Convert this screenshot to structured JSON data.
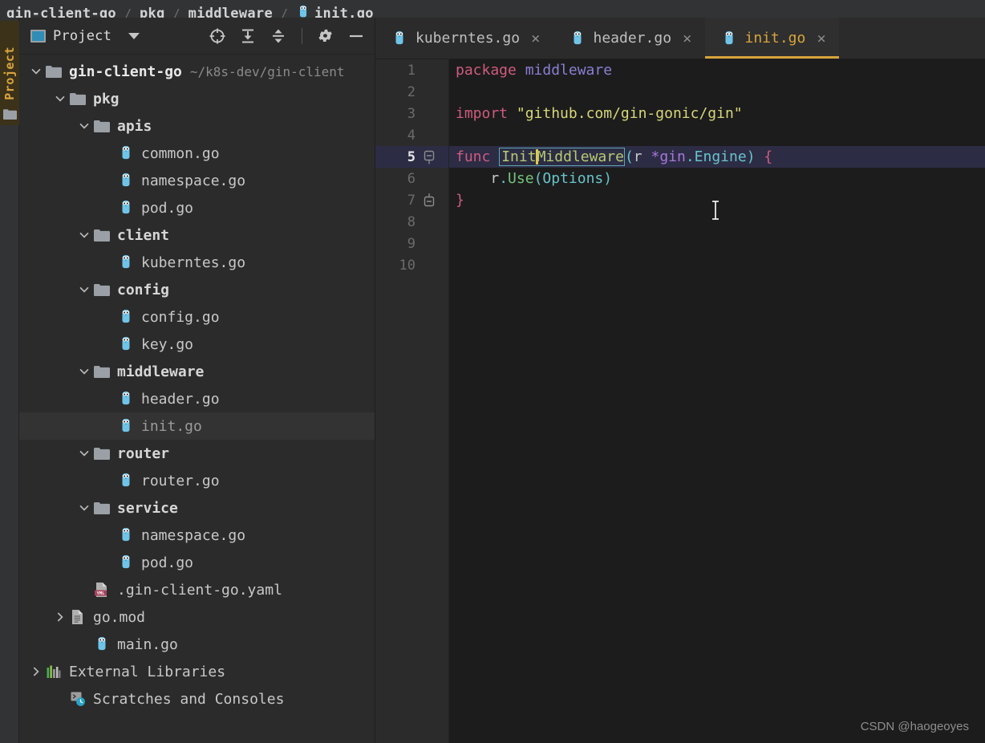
{
  "breadcrumb": {
    "items": [
      "gin-client-go",
      "pkg",
      "middleware",
      "init.go"
    ],
    "separator": "/",
    "file_icon": "go-gopher-icon"
  },
  "tool_window_tab": {
    "label": "Project",
    "icon": "folder-icon"
  },
  "project_panel": {
    "title": "Project",
    "window_icon": "project-window-icon",
    "dropdown_icon": "chevron-down-icon",
    "tools": [
      {
        "name": "locate-icon",
        "title": "Select Opened File"
      },
      {
        "name": "expand-all-icon",
        "title": "Expand All"
      },
      {
        "name": "collapse-all-icon",
        "title": "Collapse All"
      },
      {
        "name": "settings-gear-icon",
        "title": "Settings"
      },
      {
        "name": "hide-icon",
        "title": "Hide"
      }
    ],
    "tree": [
      {
        "indent": 0,
        "arrow": "expanded",
        "icon": "folder-icon",
        "label": "gin-client-go",
        "style": "root",
        "path": "~/k8s-dev/gin-client",
        "selected": false
      },
      {
        "indent": 1,
        "arrow": "expanded",
        "icon": "folder-icon",
        "label": "pkg",
        "style": "dir",
        "selected": false
      },
      {
        "indent": 2,
        "arrow": "expanded",
        "icon": "folder-icon",
        "label": "apis",
        "style": "dir",
        "selected": false
      },
      {
        "indent": 3,
        "arrow": "none",
        "icon": "go-gopher-icon",
        "label": "common.go",
        "style": "file",
        "selected": false
      },
      {
        "indent": 3,
        "arrow": "none",
        "icon": "go-gopher-icon",
        "label": "namespace.go",
        "style": "file",
        "selected": false
      },
      {
        "indent": 3,
        "arrow": "none",
        "icon": "go-gopher-icon",
        "label": "pod.go",
        "style": "file",
        "selected": false
      },
      {
        "indent": 2,
        "arrow": "expanded",
        "icon": "folder-icon",
        "label": "client",
        "style": "dir",
        "selected": false
      },
      {
        "indent": 3,
        "arrow": "none",
        "icon": "go-gopher-icon",
        "label": "kuberntes.go",
        "style": "file",
        "selected": false
      },
      {
        "indent": 2,
        "arrow": "expanded",
        "icon": "folder-icon",
        "label": "config",
        "style": "dir",
        "selected": false
      },
      {
        "indent": 3,
        "arrow": "none",
        "icon": "go-gopher-icon",
        "label": "config.go",
        "style": "file",
        "selected": false
      },
      {
        "indent": 3,
        "arrow": "none",
        "icon": "go-gopher-icon",
        "label": "key.go",
        "style": "file",
        "selected": false
      },
      {
        "indent": 2,
        "arrow": "expanded",
        "icon": "folder-icon",
        "label": "middleware",
        "style": "dir",
        "selected": false
      },
      {
        "indent": 3,
        "arrow": "none",
        "icon": "go-gopher-icon",
        "label": "header.go",
        "style": "file",
        "selected": false
      },
      {
        "indent": 3,
        "arrow": "none",
        "icon": "go-gopher-icon",
        "label": "init.go",
        "style": "file-dim",
        "selected": true
      },
      {
        "indent": 2,
        "arrow": "expanded",
        "icon": "folder-icon",
        "label": "router",
        "style": "dir",
        "selected": false
      },
      {
        "indent": 3,
        "arrow": "none",
        "icon": "go-gopher-icon",
        "label": "router.go",
        "style": "file",
        "selected": false
      },
      {
        "indent": 2,
        "arrow": "expanded",
        "icon": "folder-icon",
        "label": "service",
        "style": "dir",
        "selected": false
      },
      {
        "indent": 3,
        "arrow": "none",
        "icon": "go-gopher-icon",
        "label": "namespace.go",
        "style": "file",
        "selected": false
      },
      {
        "indent": 3,
        "arrow": "none",
        "icon": "go-gopher-icon",
        "label": "pod.go",
        "style": "file",
        "selected": false
      },
      {
        "indent": 2,
        "arrow": "none",
        "icon": "yaml-file-icon",
        "label": ".gin-client-go.yaml",
        "style": "file",
        "selected": false
      },
      {
        "indent": 1,
        "arrow": "collapsed",
        "icon": "text-file-icon",
        "label": "go.mod",
        "style": "file",
        "selected": false
      },
      {
        "indent": 2,
        "arrow": "none",
        "icon": "go-gopher-icon",
        "label": "main.go",
        "style": "file",
        "selected": false
      },
      {
        "indent": 0,
        "arrow": "collapsed",
        "icon": "libraries-icon",
        "label": "External Libraries",
        "style": "file",
        "selected": false
      },
      {
        "indent": 1,
        "arrow": "none",
        "icon": "scratches-icon",
        "label": "Scratches and Consoles",
        "style": "file",
        "selected": false
      }
    ]
  },
  "editor": {
    "tabs": [
      {
        "label": "kuberntes.go",
        "icon": "go-gopher-icon",
        "active": false,
        "close": "×"
      },
      {
        "label": "header.go",
        "icon": "go-gopher-icon",
        "active": false,
        "close": "×"
      },
      {
        "label": "init.go",
        "icon": "go-gopher-icon",
        "active": true,
        "close": "×"
      }
    ],
    "line_numbers": [
      "1",
      "2",
      "3",
      "4",
      "5",
      "6",
      "7",
      "8",
      "9",
      "10"
    ],
    "current_line": 5,
    "fold_markers": [
      {
        "line": 5,
        "type": "fold-start-icon"
      },
      {
        "line": 7,
        "type": "fold-end-icon"
      }
    ],
    "code": {
      "line1": {
        "kw": "package",
        "pkg": "middleware"
      },
      "line3": {
        "kw": "import",
        "str": "\"github.com/gin-gonic/gin\""
      },
      "line5": {
        "kw": "func",
        "ident_prefix": "Init",
        "ident_suffix": "Middleware",
        "open_paren": "(",
        "param": "r",
        "star": "*",
        "type_pkg": "gin",
        "dot": ".",
        "type_name": "Engine",
        "close_paren": ")",
        "brace": "{"
      },
      "line6": {
        "recv": "r",
        "dot": ".",
        "method": "Use",
        "open": "(",
        "arg": "Options",
        "close": ")"
      },
      "line7": {
        "brace": "}"
      }
    }
  },
  "watermark": "CSDN @haogeoyes",
  "colors": {
    "accent_gold": "#d7a43b",
    "keyword": "#cf5b7e",
    "string": "#d7d77a",
    "package": "#8a7fd4",
    "type": "#69c4c9",
    "identifier": "#b5cc6f",
    "function": "#74c47a",
    "panel_bg": "#2b2b2b",
    "editor_bg": "#1c1c1c",
    "current_line_bg": "#2c2c45",
    "selected_row_bg": "#333333"
  }
}
